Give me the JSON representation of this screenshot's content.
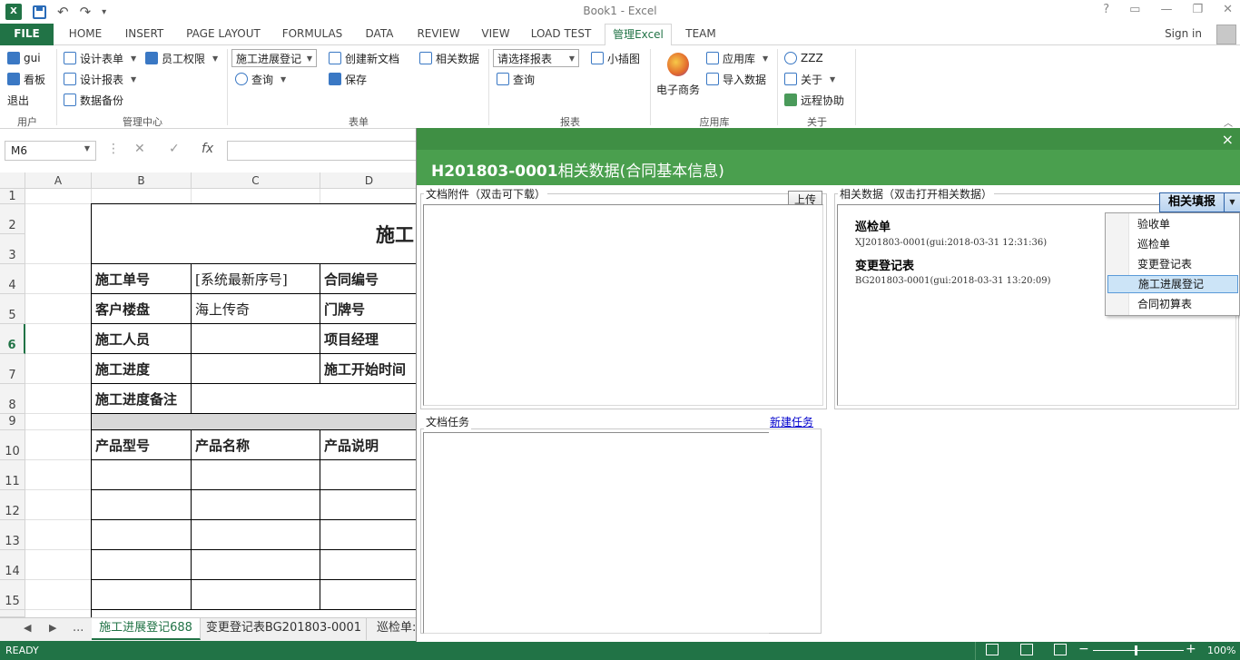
{
  "window": {
    "title": "Book1 - Excel"
  },
  "tabs": [
    "FILE",
    "HOME",
    "INSERT",
    "PAGE LAYOUT",
    "FORMULAS",
    "DATA",
    "REVIEW",
    "VIEW",
    "LOAD TEST",
    "管理Excel",
    "TEAM"
  ],
  "account": {
    "sign_in": "Sign in"
  },
  "ribbon": {
    "user_group": {
      "label": "用户",
      "user": "gui",
      "board": "看板",
      "logout": "退出"
    },
    "admin_group": {
      "label": "管理中心",
      "design_form": "设计表单",
      "staff_perm": "员工权限",
      "design_report": "设计报表",
      "backup": "数据备份"
    },
    "form_group": {
      "label": "表单",
      "form_select": "施工进展登记",
      "query": "查询",
      "new_doc": "创建新文档",
      "save": "保存",
      "related": "相关数据"
    },
    "report_group": {
      "label": "报表",
      "report_select": "请选择报表",
      "query": "查询",
      "mini_chart": "小插图"
    },
    "applib_group": {
      "label": "应用库",
      "ecommerce": "电子商务",
      "app_lib": "应用库",
      "import": "导入数据"
    },
    "about_group": {
      "label": "关于",
      "zzz": "ZZZ",
      "about": "关于",
      "remote": "远程协助"
    }
  },
  "formula_bar": {
    "name_box": "M6",
    "fx": "fx"
  },
  "sheet": {
    "columns": [
      "A",
      "B",
      "C",
      "D"
    ],
    "rows": [
      "1",
      "2",
      "3",
      "4",
      "5",
      "6",
      "7",
      "8",
      "9",
      "10",
      "11",
      "12",
      "13",
      "14",
      "15"
    ],
    "title": "施工",
    "labels": {
      "order_no": "施工单号",
      "order_val": "[系统最新序号]",
      "contract_no": "合同编号",
      "customer": "客户楼盘",
      "customer_val": "海上传奇",
      "door_no": "门牌号",
      "worker": "施工人员",
      "manager": "项目经理",
      "progress": "施工进度",
      "start_time": "施工开始时间",
      "progress_note": "施工进度备注",
      "product_model": "产品型号",
      "product_name": "产品名称",
      "product_desc": "产品说明"
    }
  },
  "sheet_tabs": {
    "more": "...",
    "items": [
      "施工进展登记688",
      "变更登记表BG201803-0001",
      "巡检单:"
    ]
  },
  "status": {
    "ready": "READY",
    "zoom": "100%"
  },
  "dialog": {
    "title_code": "H201803-0001",
    "title_rest": "相关数据(合同基本信息)",
    "close": "×",
    "attachments": {
      "legend": "文档附件（双击可下载）",
      "upload": "上传"
    },
    "related": {
      "legend": "相关数据（双击打开相关数据）",
      "fill_button": "相关填报",
      "items": [
        {
          "title": "巡检单",
          "sub": "XJ201803-0001(gui:2018-03-31 12:31:36)"
        },
        {
          "title": "变更登记表",
          "sub": "BG201803-0001(gui:2018-03-31 13:20:09)"
        }
      ]
    },
    "tasks": {
      "legend": "文档任务",
      "new_task": "新建任务"
    }
  },
  "menu": {
    "items": [
      "验收单",
      "巡检单",
      "变更登记表",
      "施工进展登记",
      "合同初算表"
    ],
    "highlighted_index": 3
  }
}
